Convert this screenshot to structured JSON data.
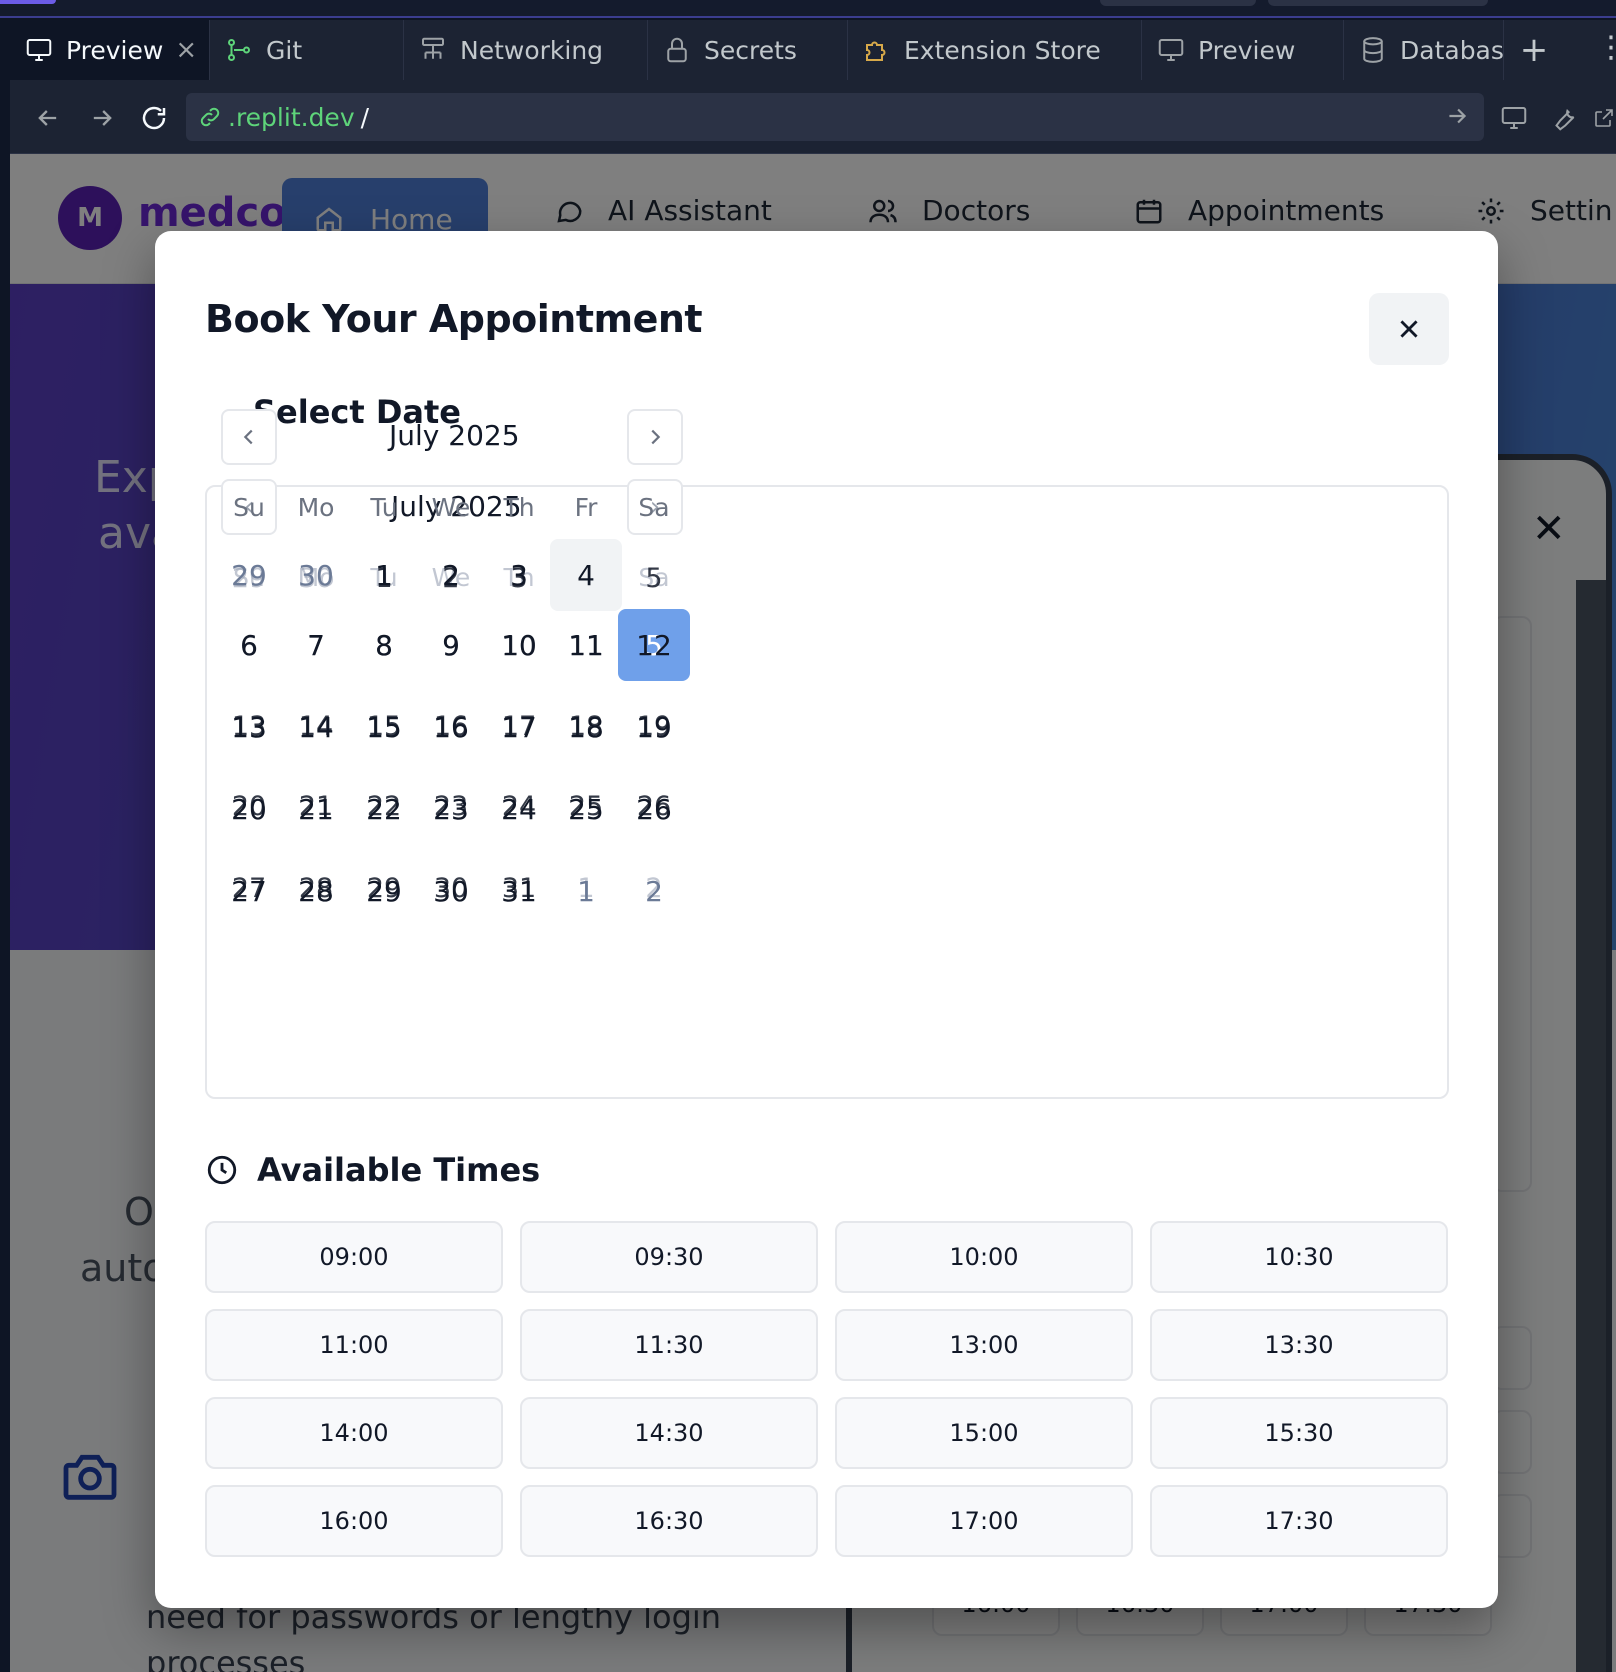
{
  "browser": {
    "tabs": [
      {
        "label": "Preview",
        "icon": "monitor-icon",
        "active": true
      },
      {
        "label": "Git",
        "icon": "git-icon"
      },
      {
        "label": "Networking",
        "icon": "network-icon"
      },
      {
        "label": "Secrets",
        "icon": "lock-icon"
      },
      {
        "label": "Extension Store",
        "icon": "puzzle-icon"
      },
      {
        "label": "Preview",
        "icon": "monitor-icon"
      },
      {
        "label": "Database",
        "icon": "database-icon"
      }
    ],
    "tab_close": "×",
    "add_tab": "+",
    "url_host": ".replit.dev",
    "url_path": "/"
  },
  "app": {
    "logo_letter": "M",
    "brand": "medcor",
    "nav": [
      {
        "label": "Home",
        "icon": "home-icon"
      },
      {
        "label": "AI Assistant",
        "icon": "chat-icon"
      },
      {
        "label": "Doctors",
        "icon": "users-icon"
      },
      {
        "label": "Appointments",
        "icon": "calendar-icon"
      },
      {
        "label": "Settin",
        "icon": "gear-icon"
      }
    ],
    "hero_lines": [
      "Exp",
      "ava"
    ],
    "side_lines": [
      "O",
      "auto"
    ],
    "bottom_lines": [
      "need for passwords or lengthy login",
      "processes"
    ],
    "bg_slots": [
      "16:00",
      "16:30",
      "17:00",
      "17:30"
    ]
  },
  "modal": {
    "title": "Book Your Appointment",
    "close_label": "×",
    "calendar": {
      "heading": "Select Date",
      "month": "July 2025",
      "prev": "‹",
      "next": "›",
      "weekdays": [
        "Su",
        "Mo",
        "Tu",
        "We",
        "Th",
        "Fr",
        "Sa"
      ],
      "weeks": [
        [
          "29",
          "30",
          "1",
          "2",
          "3",
          "4",
          "5"
        ],
        [
          "6",
          "7",
          "8",
          "9",
          "10",
          "11",
          "12"
        ],
        [
          "13",
          "14",
          "15",
          "16",
          "17",
          "18",
          "19"
        ],
        [
          "20",
          "21",
          "22",
          "23",
          "24",
          "25",
          "26"
        ],
        [
          "27",
          "28",
          "29",
          "30",
          "31",
          "1",
          "2"
        ]
      ],
      "ghost_layer": {
        "month": "July 2025",
        "weekdays": [
          "Su",
          "Mo",
          "Tu",
          "We",
          "Th",
          "Sa"
        ],
        "weeks": [
          [
            "29",
            "30",
            "1",
            "2",
            "3",
            "4",
            "5"
          ],
          [
            "6",
            "7",
            "8",
            "9",
            "10",
            "11",
            "12"
          ],
          [
            "13",
            "14",
            "15",
            "16",
            "17",
            "18",
            "19"
          ],
          [
            "20",
            "21",
            "22",
            "23",
            "24",
            "25",
            "26"
          ],
          [
            "27",
            "28",
            "29",
            "30",
            "31",
            "1",
            "2"
          ]
        ]
      },
      "today": "4",
      "selected": "5"
    },
    "times_heading": "Available Times",
    "time_slots": [
      "09:00",
      "09:30",
      "10:00",
      "10:30",
      "11:00",
      "11:30",
      "13:00",
      "13:30",
      "14:00",
      "14:30",
      "15:00",
      "15:30",
      "16:00",
      "16:30",
      "17:00",
      "17:30"
    ]
  }
}
